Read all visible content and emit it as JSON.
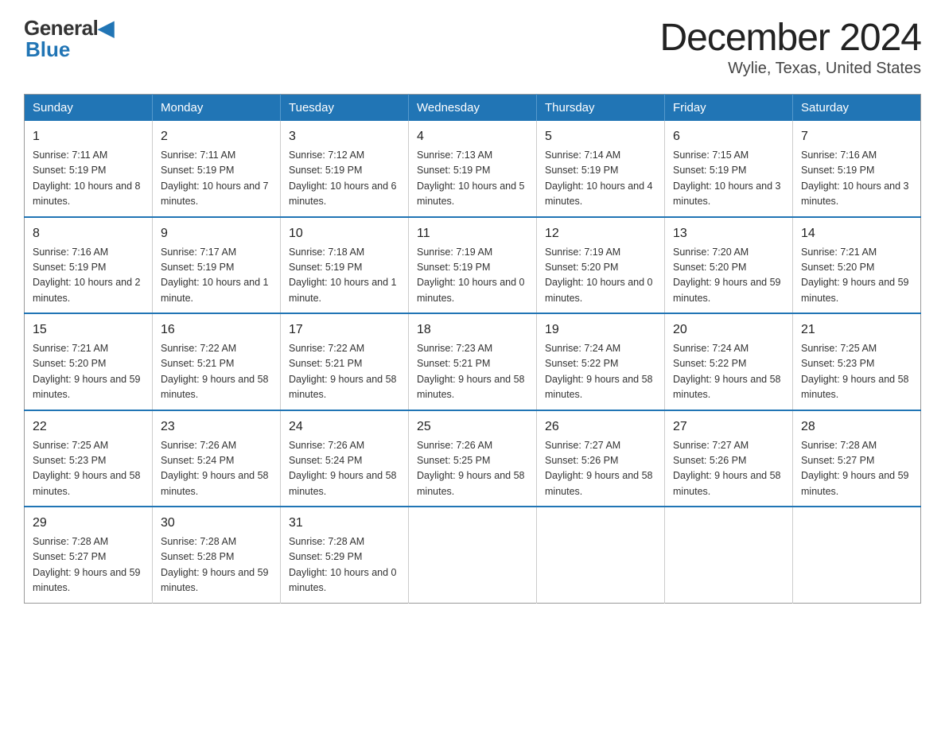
{
  "header": {
    "logo": {
      "general": "General",
      "blue": "Blue",
      "subtitle": "Blue"
    },
    "title": "December 2024",
    "location": "Wylie, Texas, United States"
  },
  "calendar": {
    "days_of_week": [
      "Sunday",
      "Monday",
      "Tuesday",
      "Wednesday",
      "Thursday",
      "Friday",
      "Saturday"
    ],
    "weeks": [
      [
        {
          "day": "1",
          "sunrise": "7:11 AM",
          "sunset": "5:19 PM",
          "daylight": "10 hours and 8 minutes."
        },
        {
          "day": "2",
          "sunrise": "7:11 AM",
          "sunset": "5:19 PM",
          "daylight": "10 hours and 7 minutes."
        },
        {
          "day": "3",
          "sunrise": "7:12 AM",
          "sunset": "5:19 PM",
          "daylight": "10 hours and 6 minutes."
        },
        {
          "day": "4",
          "sunrise": "7:13 AM",
          "sunset": "5:19 PM",
          "daylight": "10 hours and 5 minutes."
        },
        {
          "day": "5",
          "sunrise": "7:14 AM",
          "sunset": "5:19 PM",
          "daylight": "10 hours and 4 minutes."
        },
        {
          "day": "6",
          "sunrise": "7:15 AM",
          "sunset": "5:19 PM",
          "daylight": "10 hours and 3 minutes."
        },
        {
          "day": "7",
          "sunrise": "7:16 AM",
          "sunset": "5:19 PM",
          "daylight": "10 hours and 3 minutes."
        }
      ],
      [
        {
          "day": "8",
          "sunrise": "7:16 AM",
          "sunset": "5:19 PM",
          "daylight": "10 hours and 2 minutes."
        },
        {
          "day": "9",
          "sunrise": "7:17 AM",
          "sunset": "5:19 PM",
          "daylight": "10 hours and 1 minute."
        },
        {
          "day": "10",
          "sunrise": "7:18 AM",
          "sunset": "5:19 PM",
          "daylight": "10 hours and 1 minute."
        },
        {
          "day": "11",
          "sunrise": "7:19 AM",
          "sunset": "5:19 PM",
          "daylight": "10 hours and 0 minutes."
        },
        {
          "day": "12",
          "sunrise": "7:19 AM",
          "sunset": "5:20 PM",
          "daylight": "10 hours and 0 minutes."
        },
        {
          "day": "13",
          "sunrise": "7:20 AM",
          "sunset": "5:20 PM",
          "daylight": "9 hours and 59 minutes."
        },
        {
          "day": "14",
          "sunrise": "7:21 AM",
          "sunset": "5:20 PM",
          "daylight": "9 hours and 59 minutes."
        }
      ],
      [
        {
          "day": "15",
          "sunrise": "7:21 AM",
          "sunset": "5:20 PM",
          "daylight": "9 hours and 59 minutes."
        },
        {
          "day": "16",
          "sunrise": "7:22 AM",
          "sunset": "5:21 PM",
          "daylight": "9 hours and 58 minutes."
        },
        {
          "day": "17",
          "sunrise": "7:22 AM",
          "sunset": "5:21 PM",
          "daylight": "9 hours and 58 minutes."
        },
        {
          "day": "18",
          "sunrise": "7:23 AM",
          "sunset": "5:21 PM",
          "daylight": "9 hours and 58 minutes."
        },
        {
          "day": "19",
          "sunrise": "7:24 AM",
          "sunset": "5:22 PM",
          "daylight": "9 hours and 58 minutes."
        },
        {
          "day": "20",
          "sunrise": "7:24 AM",
          "sunset": "5:22 PM",
          "daylight": "9 hours and 58 minutes."
        },
        {
          "day": "21",
          "sunrise": "7:25 AM",
          "sunset": "5:23 PM",
          "daylight": "9 hours and 58 minutes."
        }
      ],
      [
        {
          "day": "22",
          "sunrise": "7:25 AM",
          "sunset": "5:23 PM",
          "daylight": "9 hours and 58 minutes."
        },
        {
          "day": "23",
          "sunrise": "7:26 AM",
          "sunset": "5:24 PM",
          "daylight": "9 hours and 58 minutes."
        },
        {
          "day": "24",
          "sunrise": "7:26 AM",
          "sunset": "5:24 PM",
          "daylight": "9 hours and 58 minutes."
        },
        {
          "day": "25",
          "sunrise": "7:26 AM",
          "sunset": "5:25 PM",
          "daylight": "9 hours and 58 minutes."
        },
        {
          "day": "26",
          "sunrise": "7:27 AM",
          "sunset": "5:26 PM",
          "daylight": "9 hours and 58 minutes."
        },
        {
          "day": "27",
          "sunrise": "7:27 AM",
          "sunset": "5:26 PM",
          "daylight": "9 hours and 58 minutes."
        },
        {
          "day": "28",
          "sunrise": "7:28 AM",
          "sunset": "5:27 PM",
          "daylight": "9 hours and 59 minutes."
        }
      ],
      [
        {
          "day": "29",
          "sunrise": "7:28 AM",
          "sunset": "5:27 PM",
          "daylight": "9 hours and 59 minutes."
        },
        {
          "day": "30",
          "sunrise": "7:28 AM",
          "sunset": "5:28 PM",
          "daylight": "9 hours and 59 minutes."
        },
        {
          "day": "31",
          "sunrise": "7:28 AM",
          "sunset": "5:29 PM",
          "daylight": "10 hours and 0 minutes."
        },
        null,
        null,
        null,
        null
      ]
    ]
  }
}
